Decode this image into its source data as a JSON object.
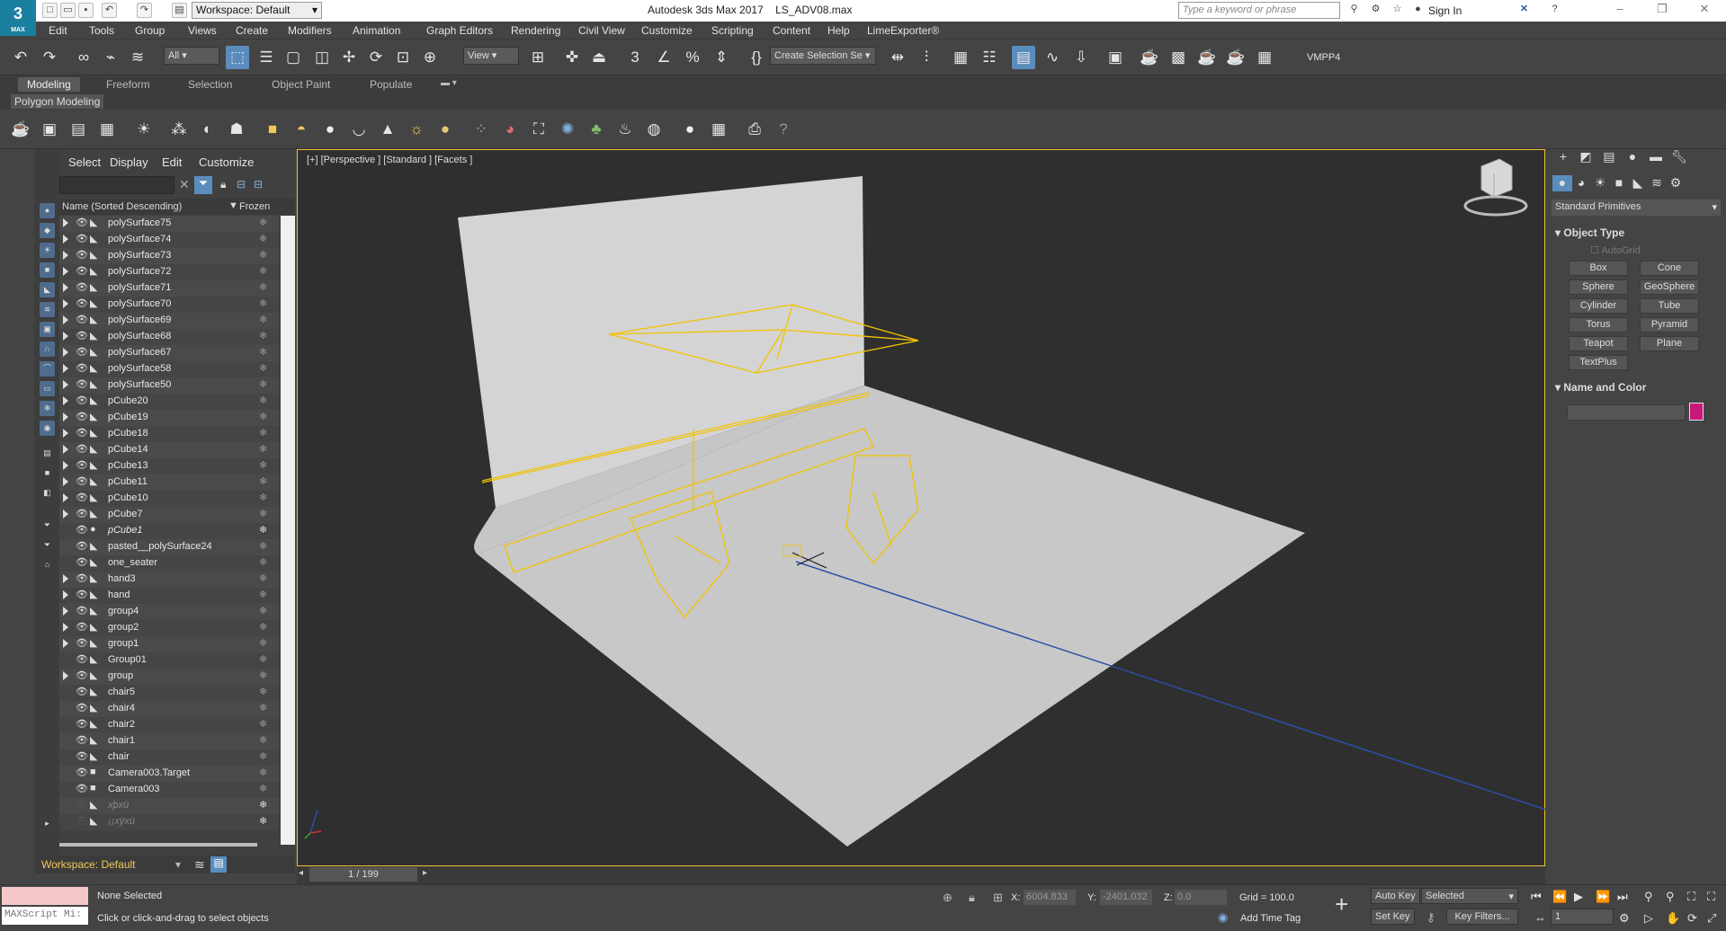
{
  "app": {
    "title": "Autodesk 3ds Max 2017",
    "file": "LS_ADV08.max",
    "logo_number": "3",
    "logo_text": "MAX",
    "workspace": "Workspace: Default",
    "search_placeholder": "Type a keyword or phrase",
    "sign_in": "Sign In"
  },
  "menu": [
    "Edit",
    "Tools",
    "Group",
    "Views",
    "Create",
    "Modifiers",
    "Animation",
    "Graph Editors",
    "Rendering",
    "Civil View",
    "Customize",
    "Scripting",
    "Content",
    "Help",
    "LimeExporter®"
  ],
  "toolbar": {
    "layer_filter": "All",
    "ref_coord": "View",
    "selection_set": "Create Selection Se",
    "vmpp": "VMPP4"
  },
  "ribbon": {
    "tabs": [
      "Modeling",
      "Freeform",
      "Selection",
      "Object Paint",
      "Populate"
    ],
    "active": "Modeling",
    "sub": "Polygon Modeling"
  },
  "scene_explorer": {
    "tabs": [
      "Select",
      "Display",
      "Edit",
      "Customize"
    ],
    "col_name": "Name (Sorted Descending)",
    "col_frozen": "Frozen",
    "rows": [
      {
        "name": "polySurface75",
        "expand": true,
        "kind": "mesh"
      },
      {
        "name": "polySurface74",
        "expand": true,
        "kind": "mesh"
      },
      {
        "name": "polySurface73",
        "expand": true,
        "kind": "mesh"
      },
      {
        "name": "polySurface72",
        "expand": true,
        "kind": "mesh"
      },
      {
        "name": "polySurface71",
        "expand": true,
        "kind": "mesh"
      },
      {
        "name": "polySurface70",
        "expand": true,
        "kind": "mesh"
      },
      {
        "name": "polySurface69",
        "expand": true,
        "kind": "mesh"
      },
      {
        "name": "polySurface68",
        "expand": true,
        "kind": "mesh"
      },
      {
        "name": "polySurface67",
        "expand": true,
        "kind": "mesh"
      },
      {
        "name": "polySurface58",
        "expand": true,
        "kind": "mesh"
      },
      {
        "name": "polySurface50",
        "expand": true,
        "kind": "mesh"
      },
      {
        "name": "pCube20",
        "expand": true,
        "kind": "mesh"
      },
      {
        "name": "pCube19",
        "expand": true,
        "kind": "mesh"
      },
      {
        "name": "pCube18",
        "expand": true,
        "kind": "mesh"
      },
      {
        "name": "pCube14",
        "expand": true,
        "kind": "mesh"
      },
      {
        "name": "pCube13",
        "expand": true,
        "kind": "mesh"
      },
      {
        "name": "pCube11",
        "expand": true,
        "kind": "mesh"
      },
      {
        "name": "pCube10",
        "expand": true,
        "kind": "mesh"
      },
      {
        "name": "pCube7",
        "expand": true,
        "kind": "mesh"
      },
      {
        "name": "pCube1",
        "expand": false,
        "kind": "dot",
        "italic": true
      },
      {
        "name": "pasted__polySurface24",
        "expand": false,
        "kind": "mesh"
      },
      {
        "name": "one_seater",
        "expand": false,
        "kind": "mesh"
      },
      {
        "name": "hand3",
        "expand": true,
        "kind": "mesh"
      },
      {
        "name": "hand",
        "expand": true,
        "kind": "mesh"
      },
      {
        "name": "group4",
        "expand": true,
        "kind": "mesh"
      },
      {
        "name": "group2",
        "expand": true,
        "kind": "mesh"
      },
      {
        "name": "group1",
        "expand": true,
        "kind": "mesh"
      },
      {
        "name": "Group01",
        "expand": false,
        "kind": "mesh"
      },
      {
        "name": "group",
        "expand": true,
        "kind": "mesh"
      },
      {
        "name": "chair5",
        "expand": false,
        "kind": "mesh"
      },
      {
        "name": "chair4",
        "expand": false,
        "kind": "mesh"
      },
      {
        "name": "chair2",
        "expand": false,
        "kind": "mesh"
      },
      {
        "name": "chair1",
        "expand": false,
        "kind": "mesh"
      },
      {
        "name": "chair",
        "expand": false,
        "kind": "mesh"
      },
      {
        "name": "Camera003.Target",
        "expand": false,
        "kind": "camera"
      },
      {
        "name": "Camera003",
        "expand": false,
        "kind": "camera"
      },
      {
        "name": "xþxü",
        "expand": false,
        "kind": "mesh",
        "dim": true
      },
      {
        "name": "¡¡xÿxü",
        "expand": false,
        "kind": "mesh",
        "dim": true
      }
    ],
    "workspace": "Workspace: Default"
  },
  "viewport": {
    "label": "[+] [Perspective ] [Standard ] [Facets ]"
  },
  "command_panel": {
    "category": "Standard Primitives",
    "object_type_title": "Object Type",
    "autogrid": "AutoGrid",
    "buttons": [
      "Box",
      "Cone",
      "Sphere",
      "GeoSphere",
      "Cylinder",
      "Tube",
      "Torus",
      "Pyramid",
      "Teapot",
      "Plane",
      "TextPlus"
    ],
    "name_color_title": "Name and Color",
    "color": "#c8187b"
  },
  "timeline": {
    "frame": "1 / 199"
  },
  "status": {
    "selection": "None Selected",
    "prompt": "Click or click-and-drag to select objects",
    "maxscript": "MAXScript Mi:",
    "x_label": "X:",
    "x_value": "6004.833",
    "y_label": "Y:",
    "y_value": "-2401.032",
    "z_label": "Z:",
    "z_value": "0.0",
    "grid": "Grid = 100.0",
    "add_time_tag": "Add Time Tag",
    "auto_key": "Auto Key",
    "set_key": "Set Key",
    "selected": "Selected",
    "key_filters": "Key Filters...",
    "frame_spinner": "1"
  }
}
